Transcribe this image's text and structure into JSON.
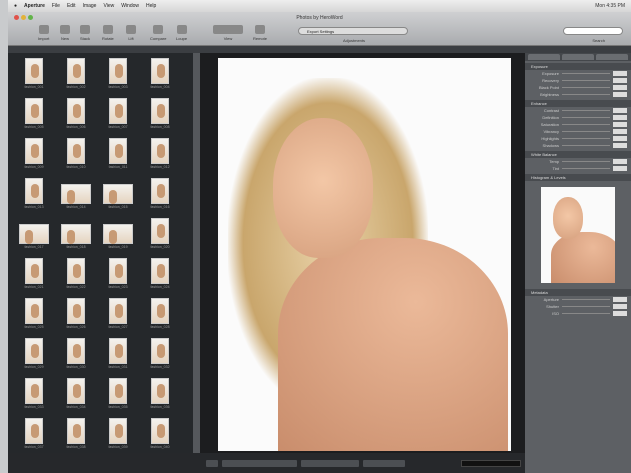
{
  "menubar": {
    "items": [
      "Aperture",
      "File",
      "Edit",
      "Image",
      "View",
      "Window",
      "Help"
    ],
    "status": "Mon 4:35 PM"
  },
  "toolbar": {
    "title": "Photos by HeroWord",
    "buttons": [
      "Import",
      "New",
      "Stack",
      "Rotate",
      "Lift",
      "Compare",
      "Loupe",
      "View",
      "Remote",
      "Adjustments"
    ],
    "segment": "Export Settings",
    "search_label": "Search"
  },
  "browser": {
    "captions": [
      "fashion_001",
      "fashion_002",
      "fashion_003",
      "fashion_004",
      "fashion_005",
      "fashion_006",
      "fashion_007",
      "fashion_008",
      "fashion_009",
      "fashion_010",
      "fashion_011",
      "fashion_012",
      "fashion_013",
      "fashion_014",
      "fashion_015",
      "fashion_016",
      "fashion_017",
      "fashion_018",
      "fashion_019",
      "fashion_020",
      "fashion_021",
      "fashion_022",
      "fashion_023",
      "fashion_024",
      "fashion_025",
      "fashion_026",
      "fashion_027",
      "fashion_028",
      "fashion_029",
      "fashion_030",
      "fashion_031",
      "fashion_032",
      "fashion_033",
      "fashion_034",
      "fashion_035",
      "fashion_036",
      "fashion_037",
      "fashion_038",
      "fashion_039",
      "fashion_040"
    ]
  },
  "inspector": {
    "sections": [
      {
        "title": "Exposure",
        "rows": [
          "Exposure",
          "Recovery",
          "Black Point",
          "Brightness"
        ]
      },
      {
        "title": "Enhance",
        "rows": [
          "Contrast",
          "Definition",
          "Saturation",
          "Vibrancy",
          "Highlights",
          "Shadows"
        ]
      },
      {
        "title": "White Balance",
        "rows": [
          "Temp",
          "Tint"
        ]
      },
      {
        "title": "Histogram & Levels",
        "rows": []
      },
      {
        "title": "Metadata",
        "rows": [
          "Aperture",
          "Shutter",
          "ISO"
        ]
      }
    ]
  }
}
